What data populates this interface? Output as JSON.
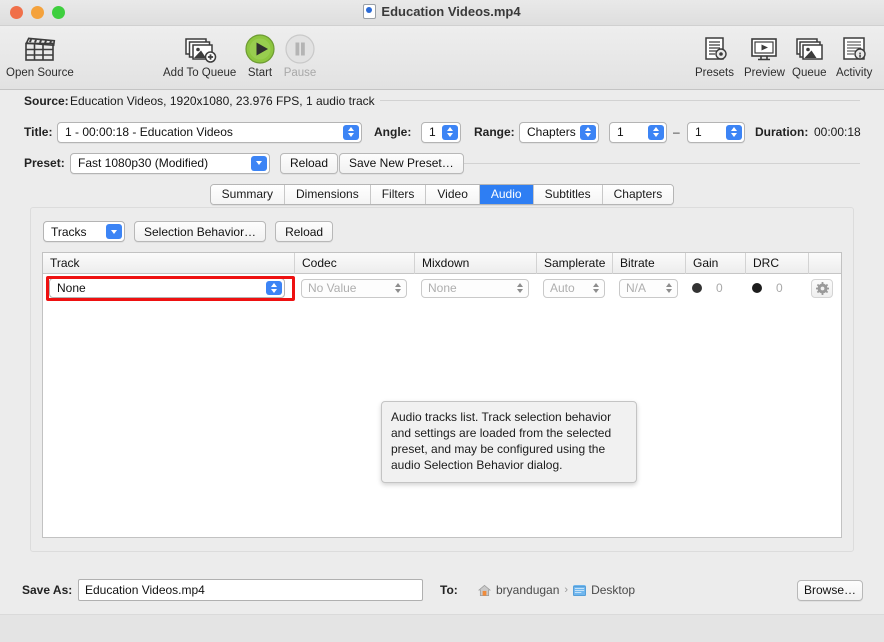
{
  "window": {
    "title": "Education Videos.mp4",
    "doc_icon": "document-icon",
    "traffic": {
      "close": "close-button",
      "minimize": "minimize-button",
      "maximize": "maximize-button"
    }
  },
  "toolbar": {
    "items": [
      {
        "id": "open-source",
        "label": "Open Source",
        "icon": "clapperboard-icon",
        "enabled": true
      },
      {
        "id": "add-to-queue",
        "label": "Add To Queue",
        "icon": "add-image-icon",
        "enabled": true
      },
      {
        "id": "start",
        "label": "Start",
        "icon": "play-icon",
        "enabled": true
      },
      {
        "id": "pause",
        "label": "Pause",
        "icon": "pause-icon",
        "enabled": false
      },
      {
        "id": "presets",
        "label": "Presets",
        "icon": "presets-icon",
        "enabled": true
      },
      {
        "id": "preview",
        "label": "Preview",
        "icon": "preview-icon",
        "enabled": true
      },
      {
        "id": "queue",
        "label": "Queue",
        "icon": "queue-icon",
        "enabled": true
      },
      {
        "id": "activity",
        "label": "Activity",
        "icon": "activity-icon",
        "enabled": true
      }
    ]
  },
  "source": {
    "label": "Source:",
    "value": "Education Videos, 1920x1080, 23.976 FPS, 1 audio track"
  },
  "title_row": {
    "label": "Title:",
    "value": "1 - 00:00:18 - Education Videos",
    "angle_label": "Angle:",
    "angle_value": "1",
    "range_label": "Range:",
    "range_value": "Chapters",
    "range_from": "1",
    "range_dash": "–",
    "range_to": "1",
    "duration_label": "Duration:",
    "duration_value": "00:00:18"
  },
  "preset_row": {
    "label": "Preset:",
    "value": "Fast 1080p30 (Modified)",
    "reload_label": "Reload",
    "save_label": "Save New Preset…"
  },
  "tabs": [
    {
      "label": "Summary",
      "active": false
    },
    {
      "label": "Dimensions",
      "active": false
    },
    {
      "label": "Filters",
      "active": false
    },
    {
      "label": "Video",
      "active": false
    },
    {
      "label": "Audio",
      "active": true
    },
    {
      "label": "Subtitles",
      "active": false
    },
    {
      "label": "Chapters",
      "active": false
    }
  ],
  "audio_panel": {
    "tracks_button": "Tracks",
    "selection_behavior_button": "Selection Behavior…",
    "reload_button": "Reload",
    "columns": [
      "Track",
      "Codec",
      "Mixdown",
      "Samplerate",
      "Bitrate",
      "Gain",
      "DRC",
      ""
    ],
    "rows": [
      {
        "track": "None",
        "codec": "No Value",
        "mixdown": "None",
        "samplerate": "Auto",
        "bitrate": "N/A",
        "gain": "0",
        "drc": "0",
        "settings_icon": "gear-icon",
        "highlighted": true
      }
    ]
  },
  "tooltip": {
    "text": "Audio tracks list. Track selection behavior and settings are loaded from the selected preset, and may be configured using the audio Selection Behavior dialog."
  },
  "bottom": {
    "save_as_label": "Save As:",
    "save_as_value": "Education Videos.mp4",
    "to_label": "To:",
    "path_user": "bryandugan",
    "path_separator": "›",
    "path_folder": "Desktop",
    "browse_label": "Browse…"
  },
  "colors": {
    "accent_blue": "#2e7ef3",
    "highlight_red": "#ee1111",
    "start_green": "#7ac143",
    "window_bg": "#ececec"
  }
}
